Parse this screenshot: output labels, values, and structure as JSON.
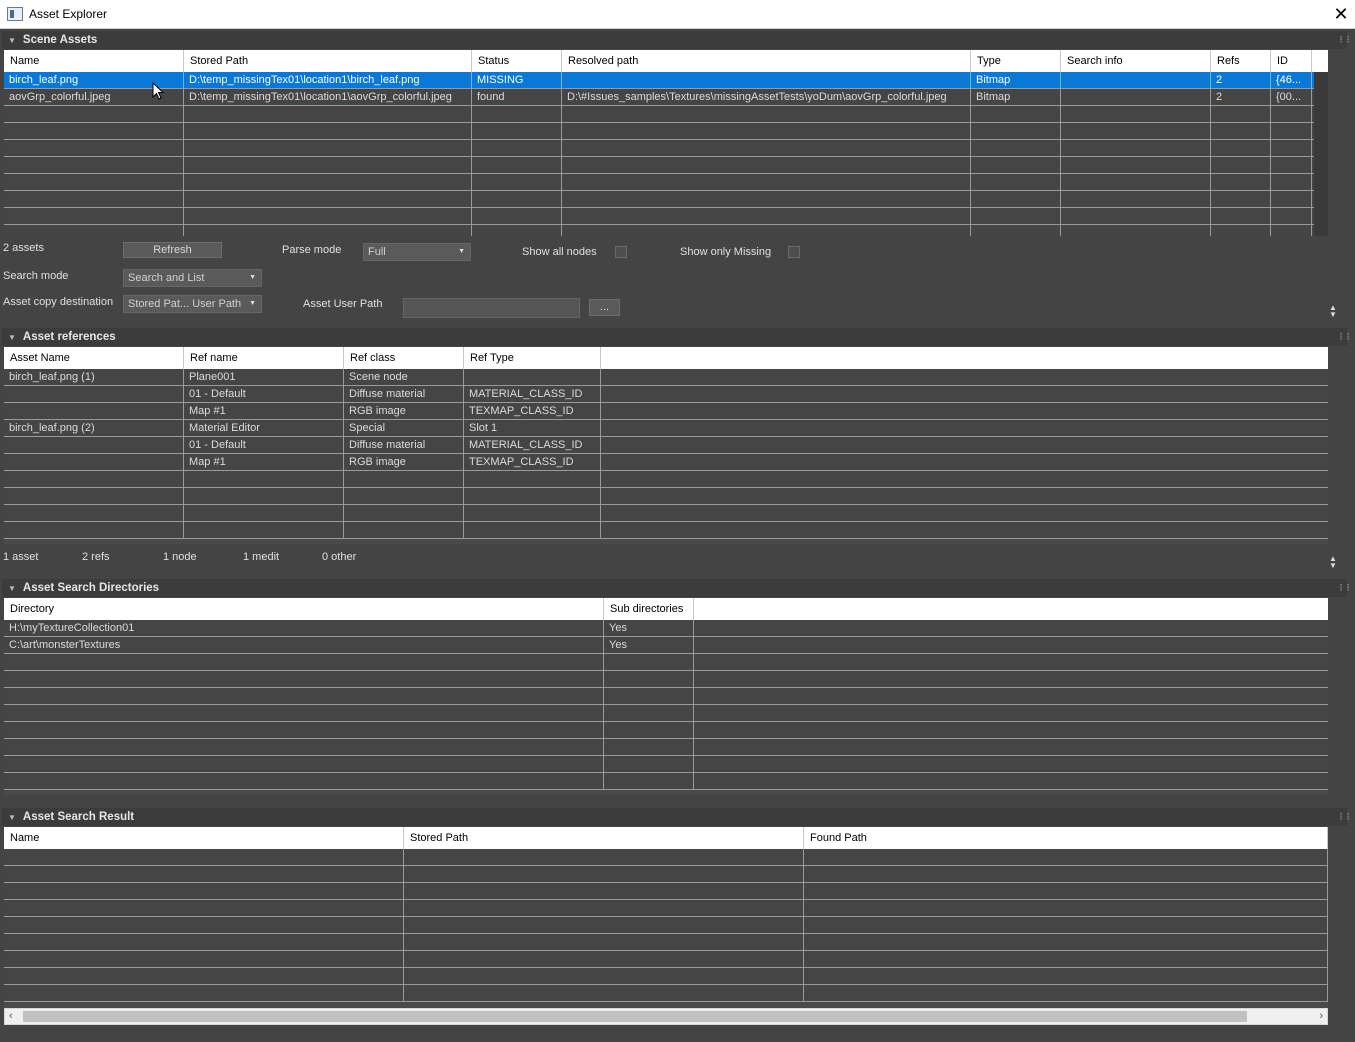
{
  "window": {
    "title": "Asset Explorer",
    "close": "✕"
  },
  "scene_assets": {
    "title": "Scene Assets",
    "columns": [
      "Name",
      "Stored Path",
      "Status",
      "Resolved path",
      "Type",
      "Search info",
      "Refs",
      "ID"
    ],
    "rows": [
      [
        "birch_leaf.png",
        "D:\\temp_missingTex01\\location1\\birch_leaf.png",
        "MISSING",
        "",
        "Bitmap",
        "",
        "2",
        "{46..."
      ],
      [
        "aovGrp_colorful.jpeg",
        "D:\\temp_missingTex01\\location1\\aovGrp_colorful.jpeg",
        "found",
        "D:\\#Issues_samples\\Textures\\missingAssetTests\\yoDum\\aovGrp_colorful.jpeg",
        "Bitmap",
        "",
        "2",
        "{00..."
      ]
    ],
    "asset_count": "2 assets",
    "refresh": "Refresh",
    "parse_mode_label": "Parse mode",
    "parse_mode_value": "Full",
    "show_all_nodes": "Show all nodes",
    "show_only_missing": "Show only Missing",
    "search_mode_label": "Search mode",
    "search_mode_value": "Search and List",
    "copy_dest_label": "Asset copy destination",
    "copy_dest_value": "Stored Pat... User Path",
    "user_path_label": "Asset User Path",
    "user_path_value": "",
    "browse": "..."
  },
  "asset_references": {
    "title": "Asset references",
    "columns": [
      "Asset Name",
      "Ref name",
      "Ref class",
      "Ref Type"
    ],
    "rows": [
      [
        "birch_leaf.png (1)",
        "Plane001",
        "Scene node",
        ""
      ],
      [
        "",
        "01 - Default",
        "Diffuse material",
        "MATERIAL_CLASS_ID"
      ],
      [
        "",
        "Map #1",
        "RGB image",
        "TEXMAP_CLASS_ID"
      ],
      [
        "birch_leaf.png (2)",
        "Material Editor",
        "Special",
        "Slot 1"
      ],
      [
        "",
        "01 - Default",
        "Diffuse material",
        "MATERIAL_CLASS_ID"
      ],
      [
        "",
        "Map #1",
        "RGB image",
        "TEXMAP_CLASS_ID"
      ]
    ],
    "stats": [
      "1 asset",
      "2 refs",
      "1 node",
      "1 medit",
      "0 other"
    ]
  },
  "search_dirs": {
    "title": "Asset Search Directories",
    "columns": [
      "Directory",
      "Sub directories"
    ],
    "rows": [
      [
        "H:\\myTextureCollection01",
        "Yes"
      ],
      [
        "C:\\art\\monsterTextures",
        "Yes"
      ]
    ]
  },
  "search_result": {
    "title": "Asset Search Result",
    "columns": [
      "Name",
      "Stored Path",
      "Found Path"
    ],
    "rows": []
  },
  "colors": {
    "selection": "#0a78d7",
    "panel": "#444444",
    "header_bg": "#ffffff"
  }
}
